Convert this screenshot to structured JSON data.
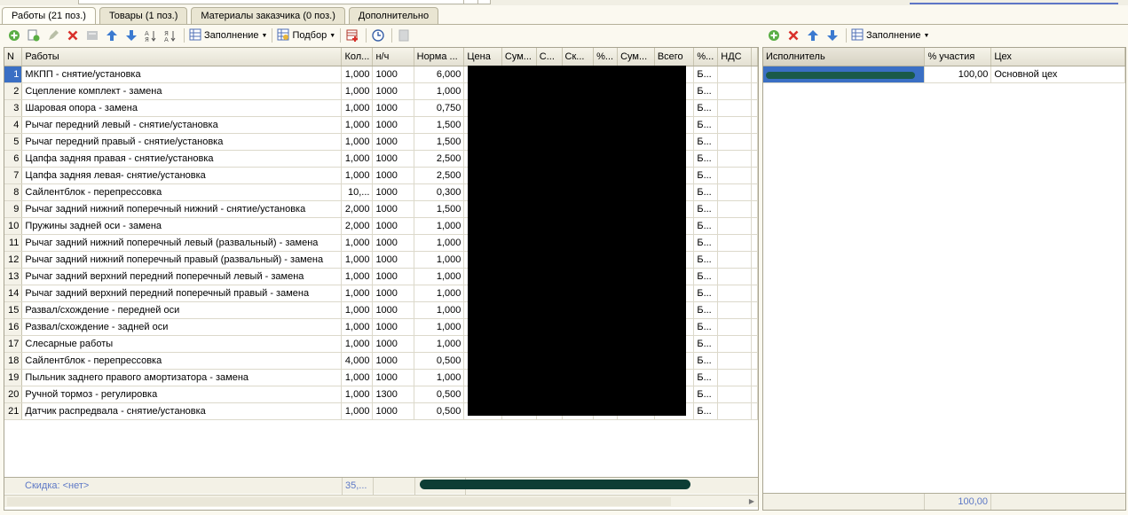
{
  "tabs": [
    {
      "label": "Работы (21 поз.)",
      "active": true
    },
    {
      "label": "Товары (1 поз.)",
      "active": false
    },
    {
      "label": "Материалы заказчика (0 поз.)",
      "active": false
    },
    {
      "label": "Дополнительно",
      "active": false
    }
  ],
  "left_toolbar": {
    "fill_label": "Заполнение",
    "pick_label": "Подбор"
  },
  "right_toolbar": {
    "fill_label": "Заполнение"
  },
  "works_table": {
    "columns": [
      "N",
      "Работы",
      "Кол...",
      "н/ч",
      "Норма ...",
      "Цена",
      "Сум...",
      "С...",
      "Ск...",
      "%...",
      "Сум...",
      "Всего",
      "%...",
      "НДС",
      ""
    ],
    "rows": [
      {
        "n": "1",
        "name": "МКПП - снятие/установка",
        "qty": "1,000",
        "nh": "1000",
        "norm": "6,000",
        "pct": "Б..."
      },
      {
        "n": "2",
        "name": "Сцепление комплект - замена",
        "qty": "1,000",
        "nh": "1000",
        "norm": "1,000",
        "pct": "Б..."
      },
      {
        "n": "3",
        "name": "Шаровая опора - замена",
        "qty": "1,000",
        "nh": "1000",
        "norm": "0,750",
        "pct": "Б..."
      },
      {
        "n": "4",
        "name": "Рычаг передний левый - снятие/установка",
        "qty": "1,000",
        "nh": "1000",
        "norm": "1,500",
        "pct": "Б..."
      },
      {
        "n": "5",
        "name": "Рычаг передний правый - снятие/установка",
        "qty": "1,000",
        "nh": "1000",
        "norm": "1,500",
        "pct": "Б..."
      },
      {
        "n": "6",
        "name": "Цапфа задняя правая - снятие/установка",
        "qty": "1,000",
        "nh": "1000",
        "norm": "2,500",
        "pct": "Б..."
      },
      {
        "n": "7",
        "name": "Цапфа задняя левая- снятие/установка",
        "qty": "1,000",
        "nh": "1000",
        "norm": "2,500",
        "pct": "Б..."
      },
      {
        "n": "8",
        "name": "Сайлентблок - перепрессовка",
        "qty": "10,...",
        "nh": "1000",
        "norm": "0,300",
        "pct": "Б..."
      },
      {
        "n": "9",
        "name": "Рычаг задний нижний поперечный нижний - снятие/установка",
        "qty": "2,000",
        "nh": "1000",
        "norm": "1,500",
        "pct": "Б..."
      },
      {
        "n": "10",
        "name": "Пружины задней оси - замена",
        "qty": "2,000",
        "nh": "1000",
        "norm": "1,000",
        "pct": "Б..."
      },
      {
        "n": "11",
        "name": "Рычаг задний нижний поперечный левый  (развальный) - замена",
        "qty": "1,000",
        "nh": "1000",
        "norm": "1,000",
        "pct": "Б..."
      },
      {
        "n": "12",
        "name": "Рычаг задний нижний поперечный правый  (развальный) - замена",
        "qty": "1,000",
        "nh": "1000",
        "norm": "1,000",
        "pct": "Б..."
      },
      {
        "n": "13",
        "name": "Рычаг задний верхний передний поперечный левый - замена",
        "qty": "1,000",
        "nh": "1000",
        "norm": "1,000",
        "pct": "Б..."
      },
      {
        "n": "14",
        "name": "Рычаг задний верхний передний поперечный правый - замена",
        "qty": "1,000",
        "nh": "1000",
        "norm": "1,000",
        "pct": "Б..."
      },
      {
        "n": "15",
        "name": "Развал/схождение - передней оси",
        "qty": "1,000",
        "nh": "1000",
        "norm": "1,000",
        "pct": "Б..."
      },
      {
        "n": "16",
        "name": "Развал/схождение - задней оси",
        "qty": "1,000",
        "nh": "1000",
        "norm": "1,000",
        "pct": "Б..."
      },
      {
        "n": "17",
        "name": "Слесарные работы",
        "qty": "1,000",
        "nh": "1000",
        "norm": "1,000",
        "pct": "Б..."
      },
      {
        "n": "18",
        "name": "Сайлентблок - перепрессовка",
        "qty": "4,000",
        "nh": "1000",
        "norm": "0,500",
        "pct": "Б..."
      },
      {
        "n": "19",
        "name": "Пыльник заднего правого амортизатора - замена",
        "qty": "1,000",
        "nh": "1000",
        "norm": "1,000",
        "pct": "Б..."
      },
      {
        "n": "20",
        "name": "Ручной тормоз - регулировка",
        "qty": "1,000",
        "nh": "1300",
        "norm": "0,500",
        "pct": "Б..."
      },
      {
        "n": "21",
        "name": "Датчик распредвала - снятие/установка",
        "qty": "1,000",
        "nh": "1000",
        "norm": "0,500",
        "pct": "Б..."
      }
    ],
    "footer": {
      "discount": "Скидка: <нет>",
      "qty_total": "35,..."
    }
  },
  "executors_table": {
    "columns": [
      "Исполнитель",
      "% участия",
      "Цех"
    ],
    "rows": [
      {
        "percent": "100,00",
        "shop": "Основной цех"
      }
    ],
    "footer": {
      "percent_total": "100,00"
    }
  }
}
